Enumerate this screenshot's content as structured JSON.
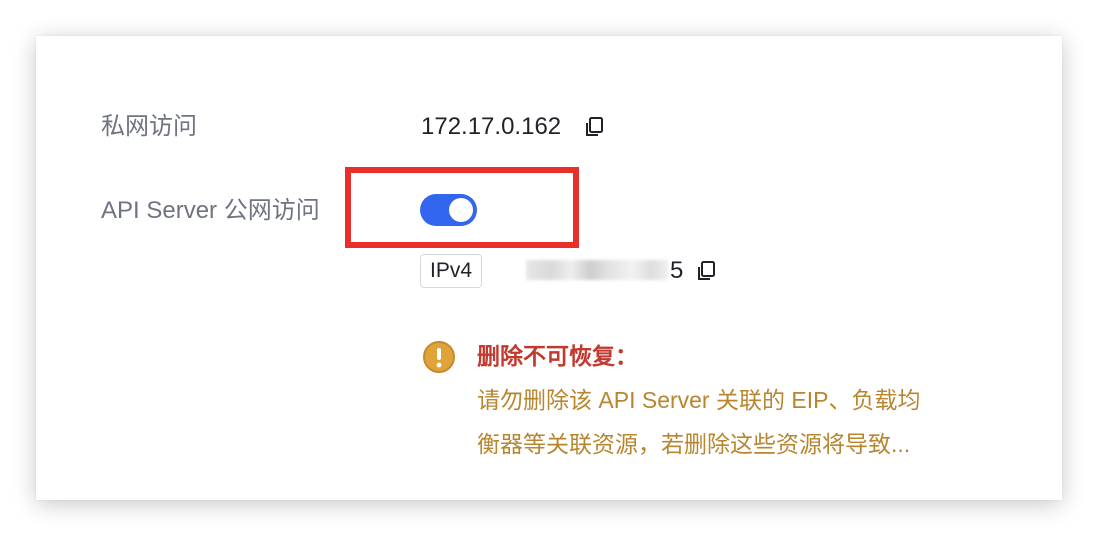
{
  "rows": {
    "private_access": {
      "label": "私网访问",
      "value": "172.17.0.162"
    },
    "public_access": {
      "label": "API Server 公网访问",
      "toggle_state": "on"
    }
  },
  "public_ip": {
    "tag": "IPv4",
    "value_visible_suffix": "5"
  },
  "warning": {
    "title": "删除不可恢复：",
    "line1": "请勿删除该 API Server 关联的 EIP、负载均",
    "line2": "衡器等关联资源，若删除这些资源将导致..."
  },
  "icons": {
    "copy": "copy-icon",
    "warning": "exclamation-circle-icon"
  },
  "colors": {
    "toggle_on": "#3366ee",
    "highlight": "#e8302a",
    "warning_title": "#c23a2f",
    "warning_text": "#b8862f",
    "warning_icon": "#e0a33a"
  }
}
